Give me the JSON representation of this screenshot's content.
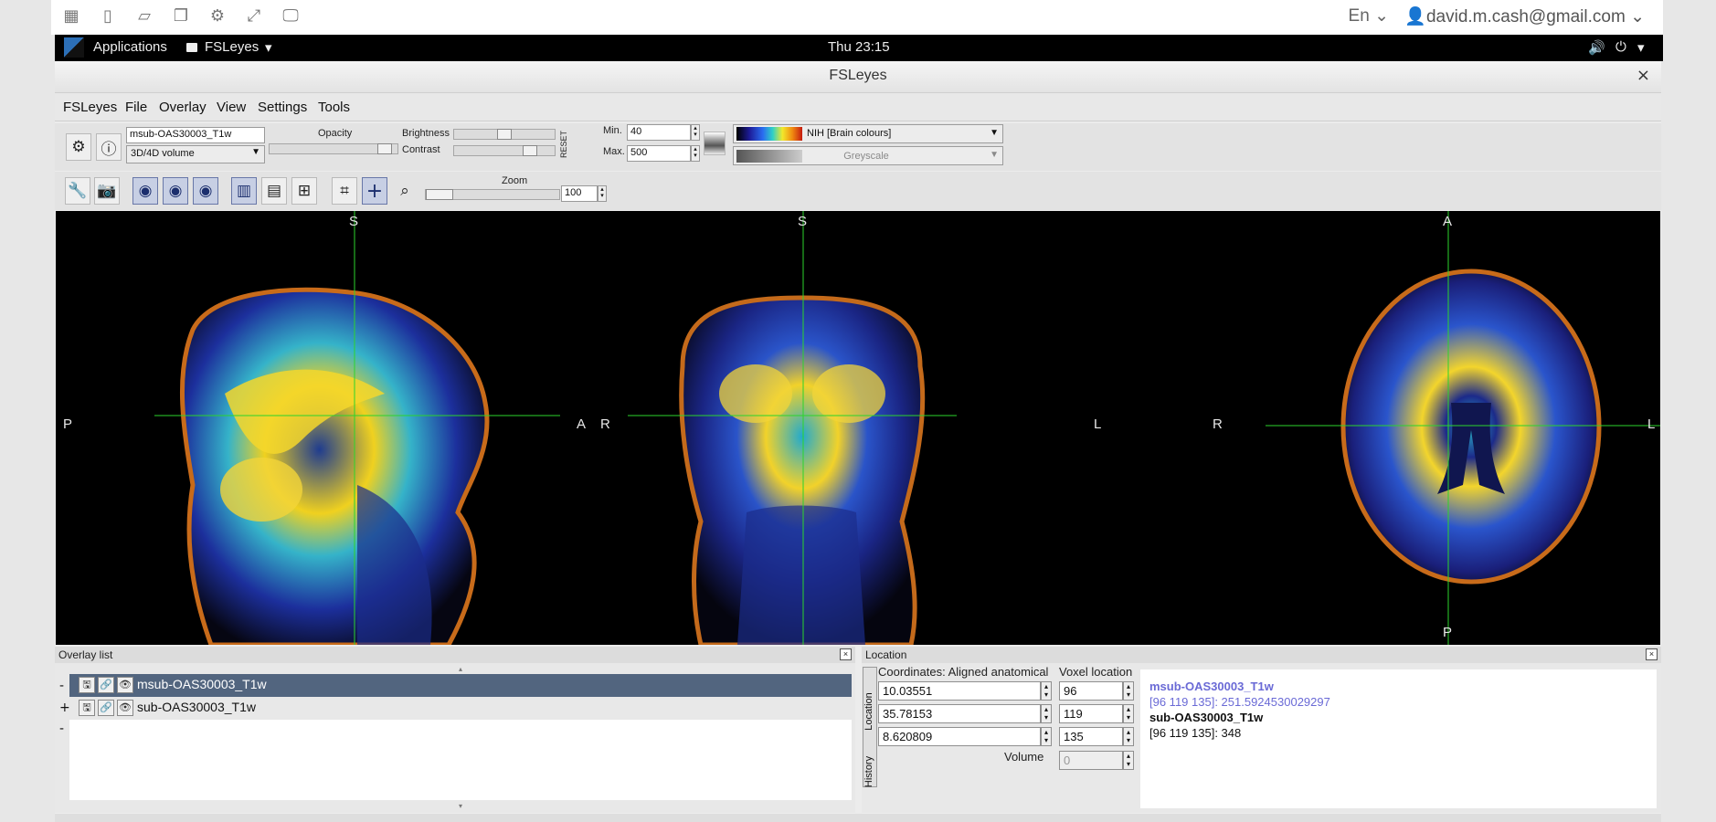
{
  "remote_bar": {
    "lang_label": "En",
    "user_email": "david.m.cash@gmail.com"
  },
  "gnome_panel": {
    "applications": "Applications",
    "active_app": "FSLeyes",
    "clock": "Thu 23:15"
  },
  "window": {
    "title": "FSLeyes",
    "close_glyph": "×"
  },
  "menubar": [
    "FSLeyes",
    "File",
    "Overlay",
    "View",
    "Settings",
    "Tools"
  ],
  "ortho_toolbar": {
    "overlay_name": "msub-OAS30003_T1w",
    "overlay_type": "3D/4D volume",
    "opacity_label": "Opacity",
    "opacity_fraction": 0.95,
    "brightness_label": "Brightness",
    "brightness_fraction": 0.5,
    "contrast_label": "Contrast",
    "contrast_fraction": 0.8,
    "reset_label": "RESET",
    "min_label": "Min.",
    "min_value": "40",
    "max_label": "Max.",
    "max_value": "500",
    "cmap_label": "NIH [Brain colours]",
    "neg_cmap_label": "Greyscale"
  },
  "view_toolbar": {
    "zoom_label": "Zoom",
    "zoom_value": "100",
    "zoom_fraction": 0.0
  },
  "canvas": {
    "sagittal": {
      "top": "S",
      "left": "P",
      "right": "A"
    },
    "coronal": {
      "top": "S",
      "left": "R",
      "right": "L"
    },
    "axial": {
      "top": "A",
      "left": "R",
      "right": "L",
      "bottom": "P"
    }
  },
  "overlay_list": {
    "title": "Overlay list",
    "items": [
      {
        "name": "msub-OAS30003_T1w",
        "selected": true,
        "expander": "-"
      },
      {
        "name": "sub-OAS30003_T1w",
        "selected": false,
        "expander": "+"
      }
    ],
    "move_up": "-"
  },
  "location": {
    "title": "Location",
    "tab_location": "Location",
    "tab_history": "History",
    "coords_label": "Coordinates: Aligned anatomical",
    "voxel_label": "Voxel location",
    "coords": [
      "10.03551",
      "35.78153",
      "8.620809"
    ],
    "voxels": [
      "96",
      "119",
      "135"
    ],
    "volume_label": "Volume",
    "volume_value": "0",
    "info": [
      {
        "name": "msub-OAS30003_T1w",
        "value": "[96 119 135]: 251.5924530029297",
        "color": "#6a6ad6"
      },
      {
        "name": "sub-OAS30003_T1w",
        "value": "[96 119 135]: 348",
        "color": "#111111"
      }
    ]
  },
  "colors": {
    "selected_row": "#52657f",
    "crosshair": "#2bd42b",
    "highlight_text": "#6a6ad6"
  }
}
